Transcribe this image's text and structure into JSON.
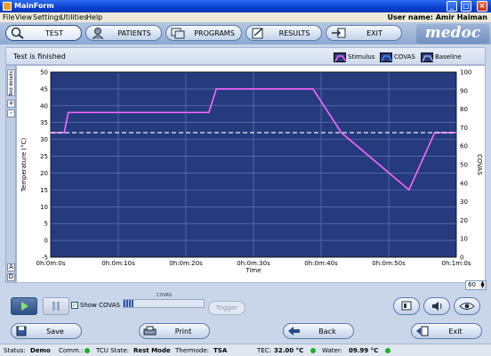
{
  "window": {
    "title": "MainForm",
    "minimize": "_",
    "maximize": "□",
    "close": "×"
  },
  "menu": {
    "items": [
      "File",
      "View",
      "Settings",
      "Utilities",
      "Help"
    ],
    "user": "User name: Amir Haiman"
  },
  "nav": {
    "tabs": [
      "TEST",
      "PATIENTS",
      "PROGRAMS",
      "RESULTS",
      "EXIT"
    ],
    "brand": "medoc"
  },
  "status_label": "Test is finished",
  "legend": [
    "Stimulus",
    "COVAS",
    "Baseline"
  ],
  "side": {
    "tab": "Test details",
    "plus": "+",
    "minus": "-",
    "btn_a": "A",
    "btn_d": "D"
  },
  "stepper_value": "60",
  "controls": {
    "show_covas": "Show COVAS",
    "covas_title": "COVAS",
    "covas_level": 0.12,
    "trigger": "Trigger"
  },
  "bottom": {
    "save": "Save",
    "print": "Print",
    "back": "Back",
    "exit": "Exit"
  },
  "statusbar": {
    "status_label": "Status:",
    "status_value": "Demo",
    "comm_label": "Comm.:",
    "tcu_label": "TCU State:",
    "tcu_value": "Rest Mode",
    "thermode_label": "Thermode:",
    "thermode_value": "TSA",
    "tec_label": "TEC:",
    "tec_value": "32.00 °C",
    "water_label": "Water:",
    "water_value": "09.99 °C"
  },
  "colors": {
    "plot_bg": "#253b7e",
    "stimulus": "#ff66ff",
    "baseline": "#ffffff",
    "grid": "#6d83bb"
  },
  "chart_data": {
    "type": "line",
    "xlabel": "Time",
    "ylabel": "Temperature (°C)",
    "y2label": "COVAS",
    "x_ticks": [
      "0h:0m:0s",
      "0h:0m:10s",
      "0h:0m:20s",
      "0h:0m:30s",
      "0h:0m:40s",
      "0h:0m:50s",
      "0h:1m:0s"
    ],
    "xlim": [
      0,
      60
    ],
    "ylim": [
      -5,
      50
    ],
    "y_ticks": [
      -5,
      0,
      5,
      10,
      15,
      20,
      25,
      30,
      35,
      40,
      45,
      50
    ],
    "y2lim": [
      0,
      100
    ],
    "y2_ticks": [
      0,
      10,
      20,
      30,
      40,
      50,
      60,
      70,
      80,
      90,
      100
    ],
    "series": [
      {
        "name": "Stimulus",
        "x": [
          0,
          2,
          2.6,
          22.7,
          23.4,
          24.5,
          38.8,
          43,
          53,
          56.8,
          60
        ],
        "y": [
          32,
          32,
          38,
          38,
          38,
          45,
          45,
          32,
          15,
          32,
          32
        ]
      },
      {
        "name": "Baseline",
        "x": [
          0,
          60
        ],
        "y": [
          32,
          32
        ]
      }
    ],
    "grid": true
  }
}
